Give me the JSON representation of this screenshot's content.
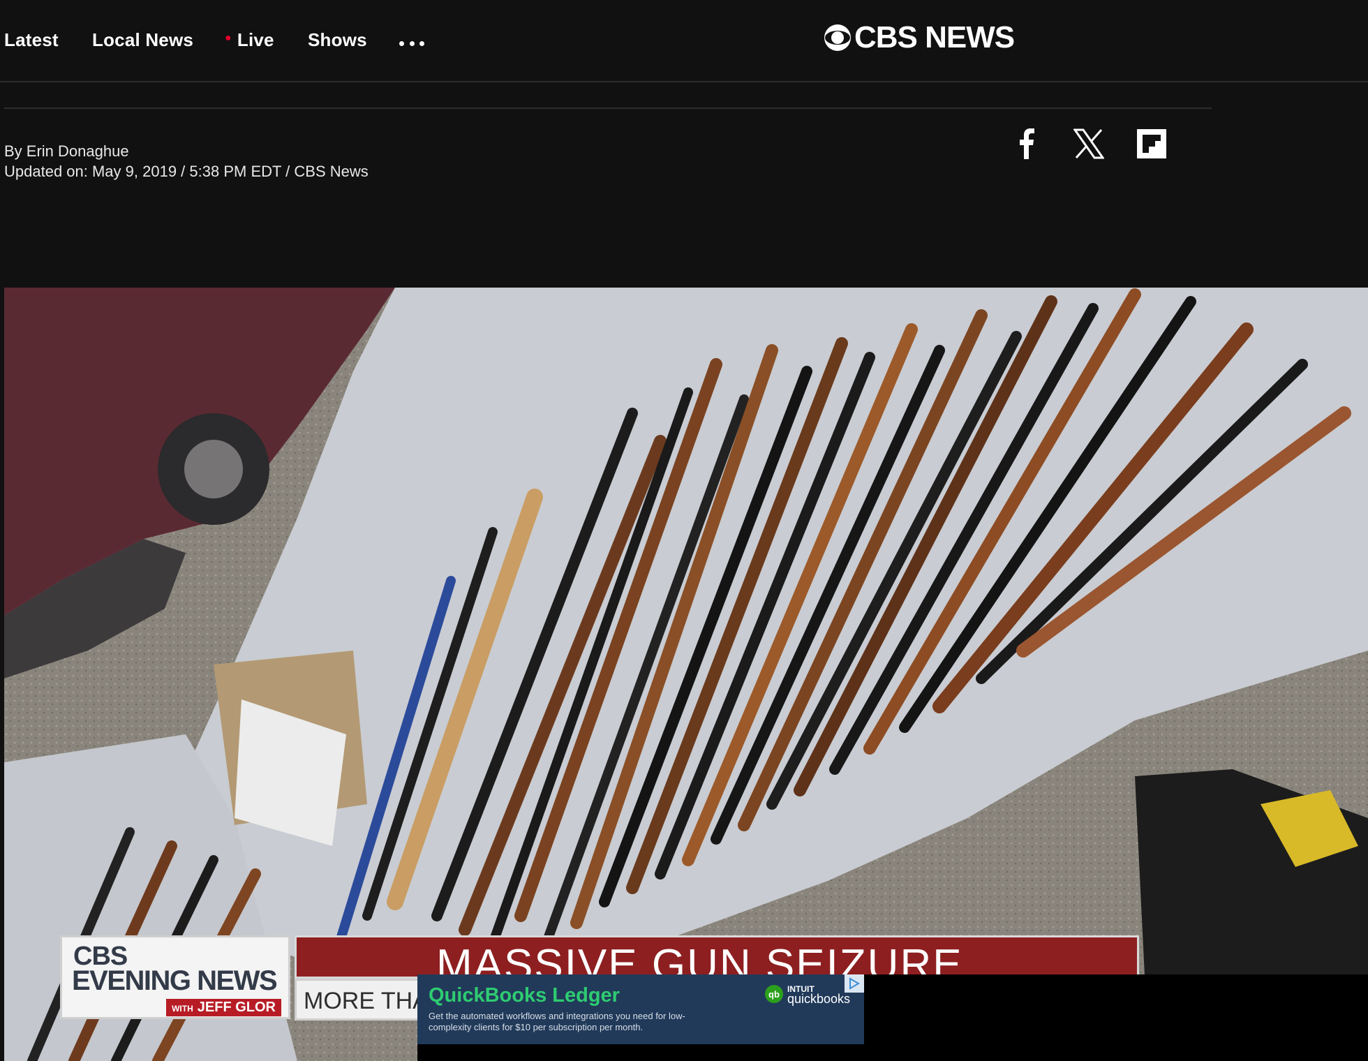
{
  "nav": {
    "items": [
      "Latest",
      "Local News",
      "Live",
      "Shows"
    ],
    "more_icon": "more-dots-icon",
    "live_dot_color": "#e4002b"
  },
  "brand": {
    "logo_text": "CBS NEWS",
    "logo_icon": "cbs-eye-icon"
  },
  "article": {
    "byline": "By Erin Donaghue",
    "updated": "Updated on: May 9, 2019 / 5:38 PM EDT / CBS News"
  },
  "share": {
    "icons": [
      "facebook-icon",
      "x-icon",
      "flipboard-icon"
    ]
  },
  "video": {
    "show_logo_line1": "CBS",
    "show_logo_line2": "EVENING NEWS",
    "show_with": "WITH",
    "show_anchor": "JEFF GLOR",
    "headline": "MASSIVE GUN SEIZURE",
    "subheadline": "MORE THA",
    "headline_color": "#8e1f20"
  },
  "ad": {
    "title": "QuickBooks Ledger",
    "body": "Get the automated workflows and integrations you need for low-complexity clients for $10 per subscription per month.",
    "brand_small": "INTUIT",
    "brand_name": "quickbooks",
    "brand_mark": "qb",
    "title_color": "#2ecc71",
    "background": "#213a5a"
  }
}
